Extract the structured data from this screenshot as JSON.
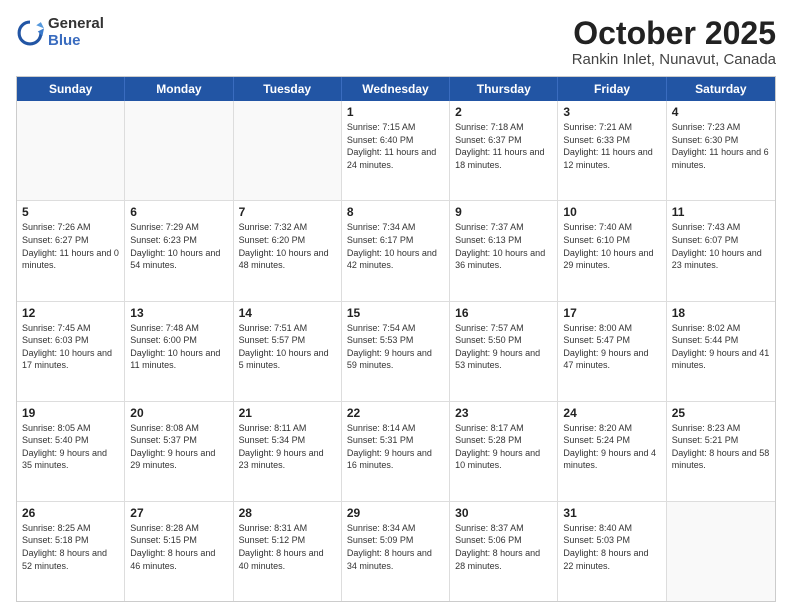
{
  "logo": {
    "general": "General",
    "blue": "Blue"
  },
  "title": "October 2025",
  "subtitle": "Rankin Inlet, Nunavut, Canada",
  "weekdays": [
    "Sunday",
    "Monday",
    "Tuesday",
    "Wednesday",
    "Thursday",
    "Friday",
    "Saturday"
  ],
  "weeks": [
    [
      {
        "day": "",
        "sunrise": "",
        "sunset": "",
        "daylight": ""
      },
      {
        "day": "",
        "sunrise": "",
        "sunset": "",
        "daylight": ""
      },
      {
        "day": "",
        "sunrise": "",
        "sunset": "",
        "daylight": ""
      },
      {
        "day": "1",
        "sunrise": "Sunrise: 7:15 AM",
        "sunset": "Sunset: 6:40 PM",
        "daylight": "Daylight: 11 hours and 24 minutes."
      },
      {
        "day": "2",
        "sunrise": "Sunrise: 7:18 AM",
        "sunset": "Sunset: 6:37 PM",
        "daylight": "Daylight: 11 hours and 18 minutes."
      },
      {
        "day": "3",
        "sunrise": "Sunrise: 7:21 AM",
        "sunset": "Sunset: 6:33 PM",
        "daylight": "Daylight: 11 hours and 12 minutes."
      },
      {
        "day": "4",
        "sunrise": "Sunrise: 7:23 AM",
        "sunset": "Sunset: 6:30 PM",
        "daylight": "Daylight: 11 hours and 6 minutes."
      }
    ],
    [
      {
        "day": "5",
        "sunrise": "Sunrise: 7:26 AM",
        "sunset": "Sunset: 6:27 PM",
        "daylight": "Daylight: 11 hours and 0 minutes."
      },
      {
        "day": "6",
        "sunrise": "Sunrise: 7:29 AM",
        "sunset": "Sunset: 6:23 PM",
        "daylight": "Daylight: 10 hours and 54 minutes."
      },
      {
        "day": "7",
        "sunrise": "Sunrise: 7:32 AM",
        "sunset": "Sunset: 6:20 PM",
        "daylight": "Daylight: 10 hours and 48 minutes."
      },
      {
        "day": "8",
        "sunrise": "Sunrise: 7:34 AM",
        "sunset": "Sunset: 6:17 PM",
        "daylight": "Daylight: 10 hours and 42 minutes."
      },
      {
        "day": "9",
        "sunrise": "Sunrise: 7:37 AM",
        "sunset": "Sunset: 6:13 PM",
        "daylight": "Daylight: 10 hours and 36 minutes."
      },
      {
        "day": "10",
        "sunrise": "Sunrise: 7:40 AM",
        "sunset": "Sunset: 6:10 PM",
        "daylight": "Daylight: 10 hours and 29 minutes."
      },
      {
        "day": "11",
        "sunrise": "Sunrise: 7:43 AM",
        "sunset": "Sunset: 6:07 PM",
        "daylight": "Daylight: 10 hours and 23 minutes."
      }
    ],
    [
      {
        "day": "12",
        "sunrise": "Sunrise: 7:45 AM",
        "sunset": "Sunset: 6:03 PM",
        "daylight": "Daylight: 10 hours and 17 minutes."
      },
      {
        "day": "13",
        "sunrise": "Sunrise: 7:48 AM",
        "sunset": "Sunset: 6:00 PM",
        "daylight": "Daylight: 10 hours and 11 minutes."
      },
      {
        "day": "14",
        "sunrise": "Sunrise: 7:51 AM",
        "sunset": "Sunset: 5:57 PM",
        "daylight": "Daylight: 10 hours and 5 minutes."
      },
      {
        "day": "15",
        "sunrise": "Sunrise: 7:54 AM",
        "sunset": "Sunset: 5:53 PM",
        "daylight": "Daylight: 9 hours and 59 minutes."
      },
      {
        "day": "16",
        "sunrise": "Sunrise: 7:57 AM",
        "sunset": "Sunset: 5:50 PM",
        "daylight": "Daylight: 9 hours and 53 minutes."
      },
      {
        "day": "17",
        "sunrise": "Sunrise: 8:00 AM",
        "sunset": "Sunset: 5:47 PM",
        "daylight": "Daylight: 9 hours and 47 minutes."
      },
      {
        "day": "18",
        "sunrise": "Sunrise: 8:02 AM",
        "sunset": "Sunset: 5:44 PM",
        "daylight": "Daylight: 9 hours and 41 minutes."
      }
    ],
    [
      {
        "day": "19",
        "sunrise": "Sunrise: 8:05 AM",
        "sunset": "Sunset: 5:40 PM",
        "daylight": "Daylight: 9 hours and 35 minutes."
      },
      {
        "day": "20",
        "sunrise": "Sunrise: 8:08 AM",
        "sunset": "Sunset: 5:37 PM",
        "daylight": "Daylight: 9 hours and 29 minutes."
      },
      {
        "day": "21",
        "sunrise": "Sunrise: 8:11 AM",
        "sunset": "Sunset: 5:34 PM",
        "daylight": "Daylight: 9 hours and 23 minutes."
      },
      {
        "day": "22",
        "sunrise": "Sunrise: 8:14 AM",
        "sunset": "Sunset: 5:31 PM",
        "daylight": "Daylight: 9 hours and 16 minutes."
      },
      {
        "day": "23",
        "sunrise": "Sunrise: 8:17 AM",
        "sunset": "Sunset: 5:28 PM",
        "daylight": "Daylight: 9 hours and 10 minutes."
      },
      {
        "day": "24",
        "sunrise": "Sunrise: 8:20 AM",
        "sunset": "Sunset: 5:24 PM",
        "daylight": "Daylight: 9 hours and 4 minutes."
      },
      {
        "day": "25",
        "sunrise": "Sunrise: 8:23 AM",
        "sunset": "Sunset: 5:21 PM",
        "daylight": "Daylight: 8 hours and 58 minutes."
      }
    ],
    [
      {
        "day": "26",
        "sunrise": "Sunrise: 8:25 AM",
        "sunset": "Sunset: 5:18 PM",
        "daylight": "Daylight: 8 hours and 52 minutes."
      },
      {
        "day": "27",
        "sunrise": "Sunrise: 8:28 AM",
        "sunset": "Sunset: 5:15 PM",
        "daylight": "Daylight: 8 hours and 46 minutes."
      },
      {
        "day": "28",
        "sunrise": "Sunrise: 8:31 AM",
        "sunset": "Sunset: 5:12 PM",
        "daylight": "Daylight: 8 hours and 40 minutes."
      },
      {
        "day": "29",
        "sunrise": "Sunrise: 8:34 AM",
        "sunset": "Sunset: 5:09 PM",
        "daylight": "Daylight: 8 hours and 34 minutes."
      },
      {
        "day": "30",
        "sunrise": "Sunrise: 8:37 AM",
        "sunset": "Sunset: 5:06 PM",
        "daylight": "Daylight: 8 hours and 28 minutes."
      },
      {
        "day": "31",
        "sunrise": "Sunrise: 8:40 AM",
        "sunset": "Sunset: 5:03 PM",
        "daylight": "Daylight: 8 hours and 22 minutes."
      },
      {
        "day": "",
        "sunrise": "",
        "sunset": "",
        "daylight": ""
      }
    ]
  ]
}
